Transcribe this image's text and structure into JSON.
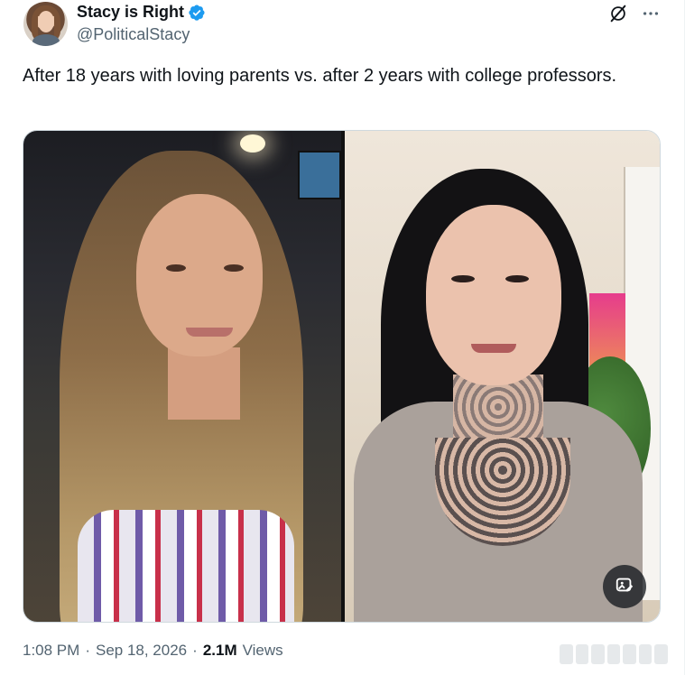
{
  "author": {
    "display_name": "Stacy is Right",
    "handle": "@PoliticalStacy",
    "verified": true,
    "verified_color": "#1d9bf0"
  },
  "tweet": {
    "text": "After 18 years with loving parents vs. after 2 years with college professors."
  },
  "media": {
    "icons": [
      "photo-edit-icon"
    ]
  },
  "meta": {
    "time": "1:08 PM",
    "separator1": "·",
    "date": "Sep 18, 2026",
    "separator2": "·",
    "views_count": "2.1M",
    "views_label": "Views"
  },
  "icons": {
    "grok": "grok-icon",
    "more": "more-icon"
  },
  "colors": {
    "text_primary": "#0f1419",
    "text_secondary": "#536471",
    "border": "#cfd9de"
  }
}
